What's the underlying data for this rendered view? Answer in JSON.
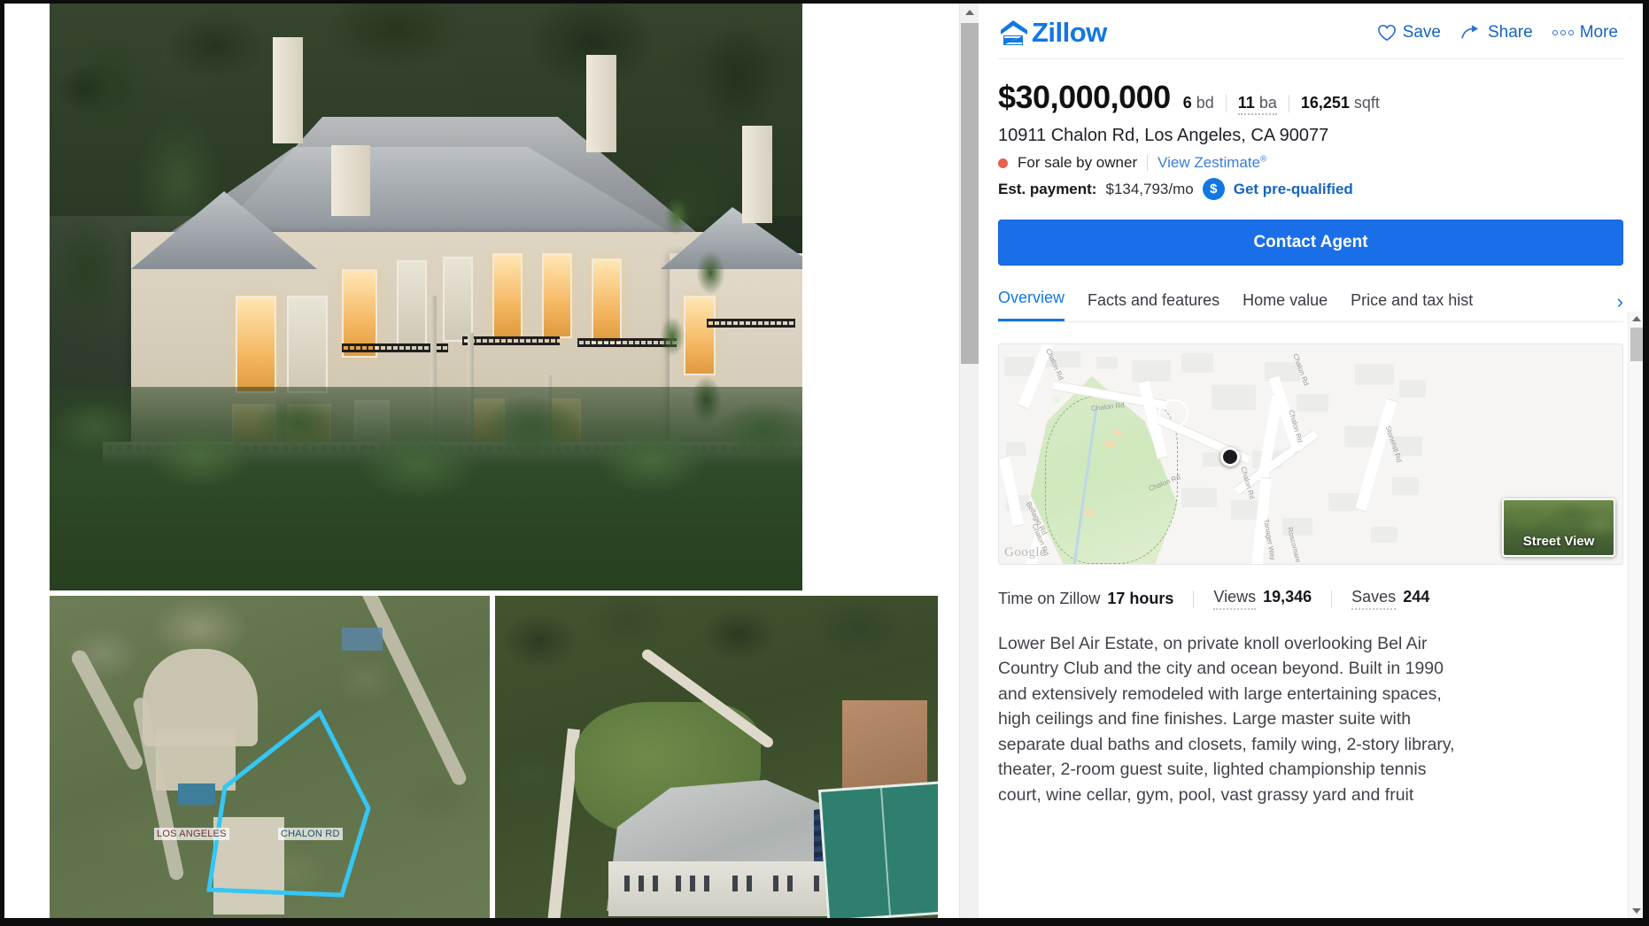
{
  "brand": {
    "name": "Zillow",
    "logo_icon": "zillow-house-icon",
    "accent_color": "#1277e1",
    "cta_color": "#1a6fe8",
    "status_dot_color": "#e8604f"
  },
  "header_actions": [
    {
      "label": "Save",
      "icon": "heart-icon"
    },
    {
      "label": "Share",
      "icon": "share-arrow-icon"
    },
    {
      "label": "More",
      "icon": "ellipsis-icon"
    }
  ],
  "listing": {
    "price": "$30,000,000",
    "beds_value": "6",
    "beds_unit": "bd",
    "baths_value": "11",
    "baths_unit": "ba",
    "sqft_value": "16,251",
    "sqft_unit": "sqft",
    "address": "10911 Chalon Rd, Los Angeles, CA 90077",
    "status": "For sale by owner",
    "zestimate_link": "View Zestimate",
    "zestimate_sup": "®",
    "payment_label": "Est. payment:",
    "payment_value": "$134,793/mo",
    "prequalified_link": "Get pre-qualified",
    "dollar_badge_icon": "dollar-circle-icon",
    "cta_label": "Contact Agent"
  },
  "tabs": [
    {
      "label": "Overview",
      "active": true
    },
    {
      "label": "Facts and features",
      "active": false
    },
    {
      "label": "Home value",
      "active": false
    },
    {
      "label": "Price and tax hist",
      "active": false
    }
  ],
  "tab_next_icon": "chevron-right-icon",
  "map": {
    "street_labels": [
      "Chalon Rd",
      "Chalon Rd",
      "Chalon Rd",
      "Chalon Rd",
      "Chalon Rd",
      "Chalon Rd",
      "Chalon Rd",
      "Stonehill Rd",
      "Tanager Way",
      "Roscomare Rd",
      "Bellagio Rd"
    ],
    "watermark": "Google",
    "marker_icon": "location-pin-icon",
    "street_view_label": "Street View"
  },
  "stats": [
    {
      "label": "Time on Zillow",
      "value": "17 hours",
      "dotted": false
    },
    {
      "label": "Views",
      "value": "19,346",
      "dotted": true
    },
    {
      "label": "Saves",
      "value": "244",
      "dotted": true
    }
  ],
  "description": "Lower Bel Air Estate, on private knoll overlooking Bel Air Country Club and the city and ocean beyond. Built in 1990 and extensively remodeled with large entertaining spaces, high ceilings and fine finishes. Large master suite with separate dual baths and closets, family wing, 2-story library, theater, 2-room guest suite, lighted championship tennis court, wine cellar, gym, pool, vast grassy yard and fruit",
  "media": {
    "hero_caption": "Twilight exterior photo of cream stucco mansion with slate roof and lit windows",
    "thumb_left_caption": "Aerial satellite view with cyan parcel boundary outline",
    "thumb_right_caption": "Aerial satellite view of mansion roof and tennis court",
    "parcel_labels": [
      "LOS ANGELES",
      "CHALON RD"
    ]
  },
  "scrollbars": {
    "page_scroll_icon": "scroll-up-arrow-icon",
    "detail_scroll_icon": "scroll-up-arrow-icon"
  }
}
